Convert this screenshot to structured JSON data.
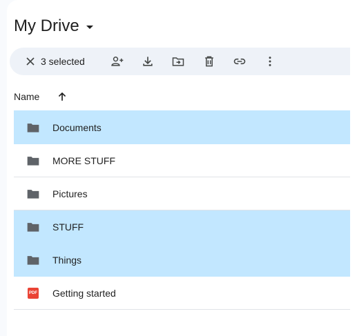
{
  "header": {
    "title": "My Drive"
  },
  "toolbar": {
    "selected_text": "3 selected",
    "actions": [
      "clear-selection",
      "share",
      "download",
      "move",
      "delete",
      "copy-link",
      "more-actions"
    ]
  },
  "columns": {
    "name": "Name"
  },
  "files": [
    {
      "name": "Documents",
      "type": "folder",
      "selected": true
    },
    {
      "name": "MORE STUFF",
      "type": "folder",
      "selected": false
    },
    {
      "name": "Pictures",
      "type": "folder",
      "selected": false
    },
    {
      "name": "STUFF",
      "type": "folder",
      "selected": true
    },
    {
      "name": "Things",
      "type": "folder",
      "selected": true
    },
    {
      "name": "Getting started",
      "type": "pdf",
      "selected": false,
      "icon_text": "PDF"
    }
  ],
  "colors": {
    "selection": "#c2e7ff",
    "toolbar": "#eef2f8",
    "pdf": "#ea4335",
    "folder": "#5f6368"
  }
}
